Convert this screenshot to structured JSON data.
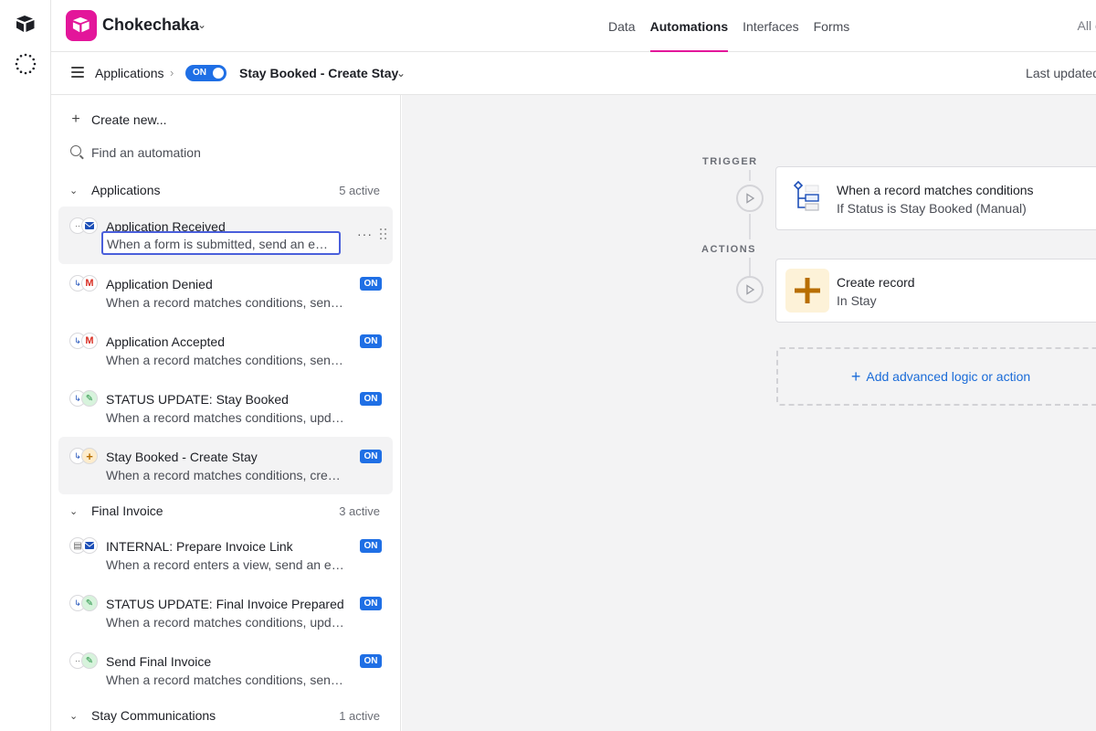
{
  "app": {
    "base_name": "Chokechaka",
    "nav": [
      "Data",
      "Automations",
      "Interfaces",
      "Forms"
    ],
    "nav_active": "Automations",
    "right_truncated": "All c"
  },
  "subheader": {
    "breadcrumb": "Applications",
    "toggle_label": "ON",
    "automation_title": "Stay Booked - Create Stay",
    "last_updated": "Last updated"
  },
  "sidebar": {
    "create_new": "Create new...",
    "search_placeholder": "Find an automation",
    "groups": [
      {
        "name": "Applications",
        "count": "5 active",
        "items": [
          {
            "title": "Application Received",
            "desc": "When a form is submitted, send an ema...",
            "on": "",
            "editing": true,
            "icons": [
              "form-trigger-icon",
              "email-icon"
            ]
          },
          {
            "title": "Application Denied",
            "desc": "When a record matches conditions, send ...",
            "on": "ON",
            "icons": [
              "conditions-icon",
              "gmail-icon"
            ]
          },
          {
            "title": "Application Accepted",
            "desc": "When a record matches conditions, send ...",
            "on": "ON",
            "icons": [
              "conditions-icon",
              "gmail-icon"
            ]
          },
          {
            "title": "STATUS UPDATE: Stay Booked",
            "desc": "When a record matches conditions, upda...",
            "on": "ON",
            "icons": [
              "conditions-icon",
              "pencil-icon"
            ]
          },
          {
            "title": "Stay Booked - Create Stay",
            "desc": "When a record matches conditions, creat...",
            "on": "ON",
            "selected": true,
            "icons": [
              "conditions-icon",
              "plus-icon"
            ]
          }
        ]
      },
      {
        "name": "Final Invoice",
        "count": "3 active",
        "items": [
          {
            "title": "INTERNAL: Prepare Invoice Link",
            "desc": "When a record enters a view, send an email",
            "on": "ON",
            "icons": [
              "view-icon",
              "email-icon"
            ]
          },
          {
            "title": "STATUS UPDATE: Final Invoice Prepared",
            "desc": "When a record matches conditions, upda...",
            "on": "ON",
            "icons": [
              "conditions-icon",
              "pencil-icon"
            ]
          },
          {
            "title": "Send Final Invoice",
            "desc": "When a record matches conditions, send ...",
            "on": "ON",
            "icons": [
              "button-trigger-icon",
              "pencil-icon"
            ]
          }
        ]
      },
      {
        "name": "Stay Communications",
        "count": "1 active",
        "items": []
      }
    ]
  },
  "canvas": {
    "trigger_label": "TRIGGER",
    "actions_label": "ACTIONS",
    "trigger": {
      "title": "When a record matches conditions",
      "subtitle": "If Status is Stay Booked (Manual)"
    },
    "action": {
      "title": "Create record",
      "subtitle": "In Stay"
    },
    "add_label": "Add advanced logic or action"
  },
  "colors": {
    "brand_pink": "#e3169a",
    "on_blue": "#1f6fe5",
    "link_blue": "#1a6bd8",
    "edit_outline": "#4a5fdb"
  }
}
